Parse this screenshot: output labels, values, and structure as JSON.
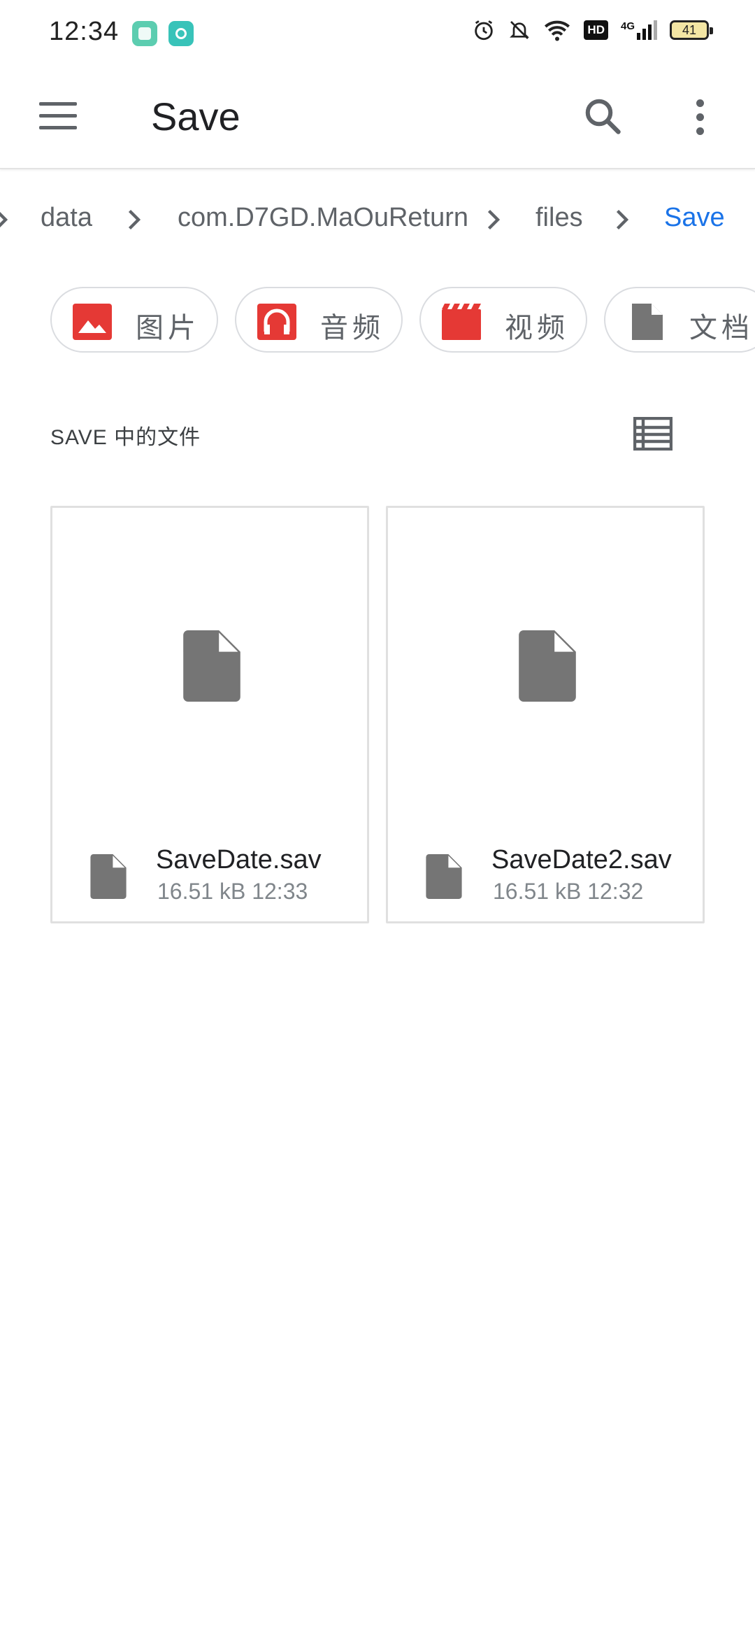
{
  "status_bar": {
    "time": "12:34",
    "battery": "41",
    "icons": [
      "app-icon-1",
      "app-icon-2",
      "alarm-icon",
      "mute-icon",
      "wifi-icon",
      "hd-icon",
      "4g-signal-icon",
      "battery-icon"
    ],
    "hd_label": "HD",
    "network_label": "4G"
  },
  "app_bar": {
    "title": "Save",
    "icons": [
      "menu-icon",
      "search-icon",
      "more-vert-icon"
    ]
  },
  "breadcrumb": {
    "items": [
      "data",
      "com.D7GD.MaOuReturn",
      "files",
      "Save"
    ],
    "current": "Save"
  },
  "filter_chips": [
    {
      "label": "图片",
      "icon": "image-icon",
      "color": "#e53935"
    },
    {
      "label": "音频",
      "icon": "headphones-icon",
      "color": "#e53935"
    },
    {
      "label": "视频",
      "icon": "movie-icon",
      "color": "#e53935"
    },
    {
      "label": "文档",
      "icon": "document-icon",
      "color": "#757575"
    }
  ],
  "section": {
    "title": "SAVE 中的文件",
    "view_toggle_icon": "list-view-icon"
  },
  "files": [
    {
      "name": "SaveDate.sav",
      "size": "16.51 kB",
      "time": "12:33",
      "meta": "16.51 kB  12:33"
    },
    {
      "name": "SaveDate2.sav",
      "size": "16.51 kB",
      "time": "12:32",
      "meta": "16.51 kB  12:32"
    }
  ],
  "colors": {
    "accent": "#1a73e8",
    "icon_grey": "#757575",
    "chip_red": "#e53935"
  }
}
